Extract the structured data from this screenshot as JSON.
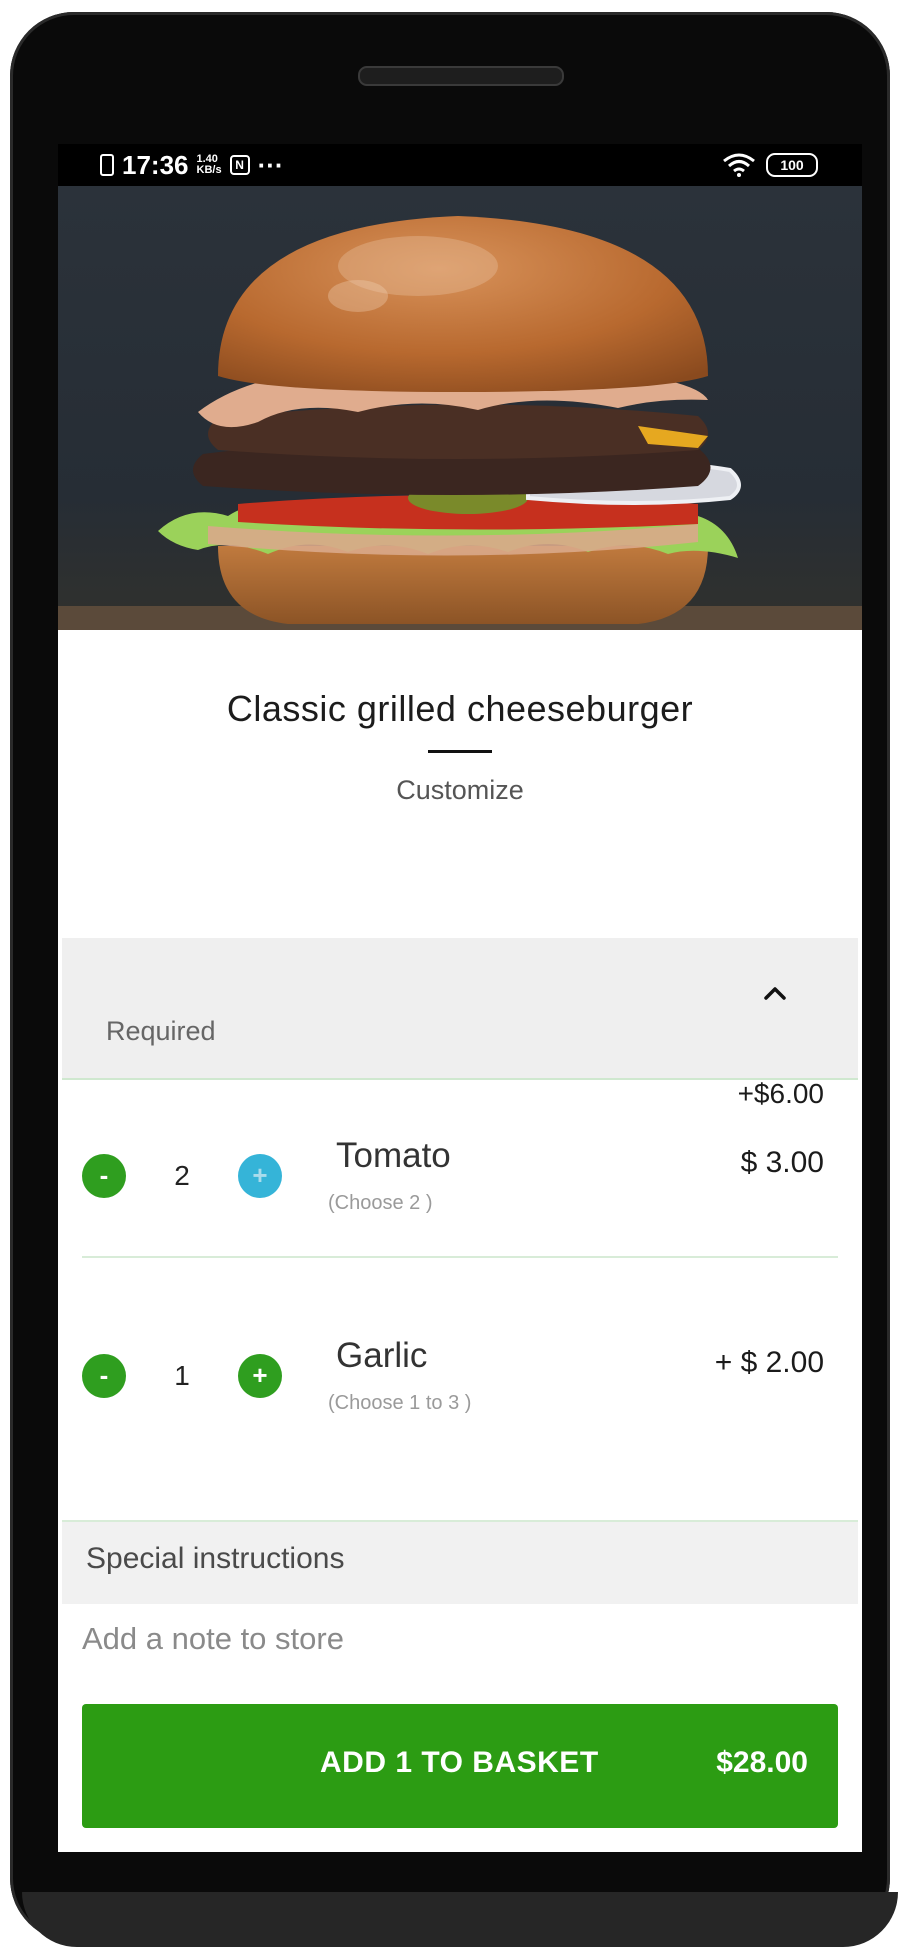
{
  "status_bar": {
    "time": "17:36",
    "network_speed_top": "1.40",
    "network_speed_bottom": "KB/s",
    "nfc_icon_label": "N",
    "overflow": "···",
    "battery_level": "100"
  },
  "product": {
    "title": "Classic grilled cheeseburger",
    "subtitle": "Customize"
  },
  "required_section": {
    "label": "Required",
    "toggle_icon": "chevron-up-icon"
  },
  "options": [
    {
      "name": "Tomato",
      "hint": "(Choose 2 )",
      "quantity": "2",
      "extra_price": "+$6.00",
      "price": "$ 3.00",
      "decrement_label": "-",
      "increment_label": "+"
    },
    {
      "name": "Garlic",
      "hint": "(Choose 1 to 3 )",
      "quantity": "1",
      "price": "+ $ 2.00",
      "decrement_label": "-",
      "increment_label": "+"
    }
  ],
  "special_instructions": {
    "label": "Special instructions",
    "placeholder": "Add a note to store"
  },
  "cta": {
    "label": "ADD 1 TO BASKET",
    "price": "$28.00"
  },
  "colors": {
    "accent_green": "#2c9c13",
    "increment_disabled_blue": "#35b4d8"
  }
}
